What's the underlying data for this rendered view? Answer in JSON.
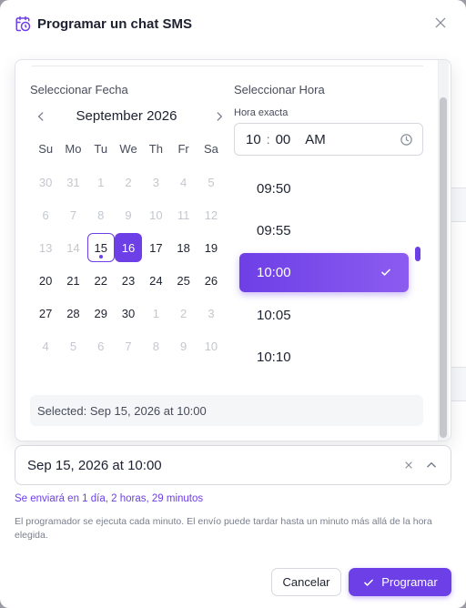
{
  "dialog": {
    "title": "Programar un chat SMS",
    "accent": "#6d3fe6"
  },
  "popover": {
    "date_section_title": "Seleccionar Fecha",
    "time_section_title": "Seleccionar Hora",
    "calendar": {
      "month_label": "September 2026",
      "weekdays": [
        "Su",
        "Mo",
        "Tu",
        "We",
        "Th",
        "Fr",
        "Sa"
      ],
      "weeks": [
        [
          {
            "d": "30",
            "m": true
          },
          {
            "d": "31",
            "m": true
          },
          {
            "d": "1",
            "m": true
          },
          {
            "d": "2",
            "m": true
          },
          {
            "d": "3",
            "m": true
          },
          {
            "d": "4",
            "m": true
          },
          {
            "d": "5",
            "m": true
          }
        ],
        [
          {
            "d": "6",
            "m": true
          },
          {
            "d": "7",
            "m": true
          },
          {
            "d": "8",
            "m": true
          },
          {
            "d": "9",
            "m": true
          },
          {
            "d": "10",
            "m": true
          },
          {
            "d": "11",
            "m": true
          },
          {
            "d": "12",
            "m": true
          }
        ],
        [
          {
            "d": "13",
            "m": true
          },
          {
            "d": "14",
            "m": true
          },
          {
            "d": "15",
            "today": true
          },
          {
            "d": "16",
            "sel": true
          },
          {
            "d": "17"
          },
          {
            "d": "18"
          },
          {
            "d": "19"
          }
        ],
        [
          {
            "d": "20"
          },
          {
            "d": "21"
          },
          {
            "d": "22"
          },
          {
            "d": "23"
          },
          {
            "d": "24"
          },
          {
            "d": "25"
          },
          {
            "d": "26"
          }
        ],
        [
          {
            "d": "27"
          },
          {
            "d": "28"
          },
          {
            "d": "29"
          },
          {
            "d": "30"
          },
          {
            "d": "1",
            "m": true
          },
          {
            "d": "2",
            "m": true
          },
          {
            "d": "3",
            "m": true
          }
        ],
        [
          {
            "d": "4",
            "m": true
          },
          {
            "d": "5",
            "m": true
          },
          {
            "d": "6",
            "m": true
          },
          {
            "d": "7",
            "m": true
          },
          {
            "d": "8",
            "m": true
          },
          {
            "d": "9",
            "m": true
          },
          {
            "d": "10",
            "m": true
          }
        ]
      ]
    },
    "exact_time": {
      "label": "Hora exacta",
      "hour": "10",
      "minute": "00",
      "period": "AM"
    },
    "time_options": [
      {
        "label": "09:50"
      },
      {
        "label": "09:55"
      },
      {
        "label": "10:00",
        "selected": true
      },
      {
        "label": "10:05"
      },
      {
        "label": "10:10"
      }
    ],
    "selected_summary": "Selected: Sep 15, 2026 at 10:00"
  },
  "field": {
    "value": "Sep 15, 2026 at 10:00"
  },
  "sends_in": "Se enviará en 1 día, 2 horas, 29 minutos",
  "note": "El programador se ejecuta cada minuto. El envío puede tardar hasta un minuto más allá de la hora elegida.",
  "buttons": {
    "cancel": "Cancelar",
    "submit": "Programar"
  }
}
